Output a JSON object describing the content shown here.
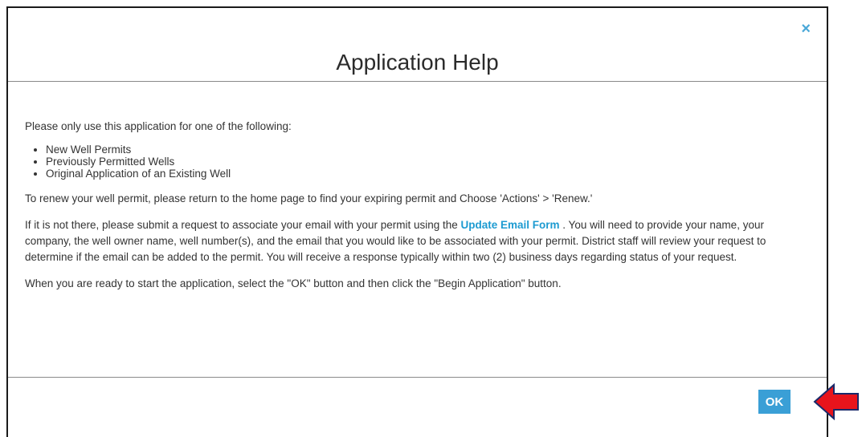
{
  "dialog": {
    "title": "Application Help",
    "close_glyph": "×",
    "intro": "Please only use this application for one of the following:",
    "items": [
      "New Well Permits",
      "Previously Permitted Wells",
      "Original Application of an Existing Well"
    ],
    "renew_text": "To renew your well permit, please return to the home page to find your expiring permit and Choose 'Actions' > 'Renew.'",
    "request_before": "If it is not there, please submit a request to associate your email with your permit using the ",
    "request_link": "Update Email Form",
    "request_after": " . You will need to provide your name, your company, the well owner name, well number(s), and the email that you would like to be associated with your permit. District staff will review your request to determine if the email can be added to the permit. You will receive a response typically within two (2) business days regarding status of your request.",
    "ready_text": "When you are ready to start the application, select the \"OK\" button and then click the \"Begin Application\" button.",
    "ok_label": "OK"
  },
  "colors": {
    "accent": "#3a9fd6",
    "link": "#1d9bd1",
    "arrow": "#e8141c"
  },
  "icons": [
    "close-icon",
    "red-arrow-pointer"
  ]
}
